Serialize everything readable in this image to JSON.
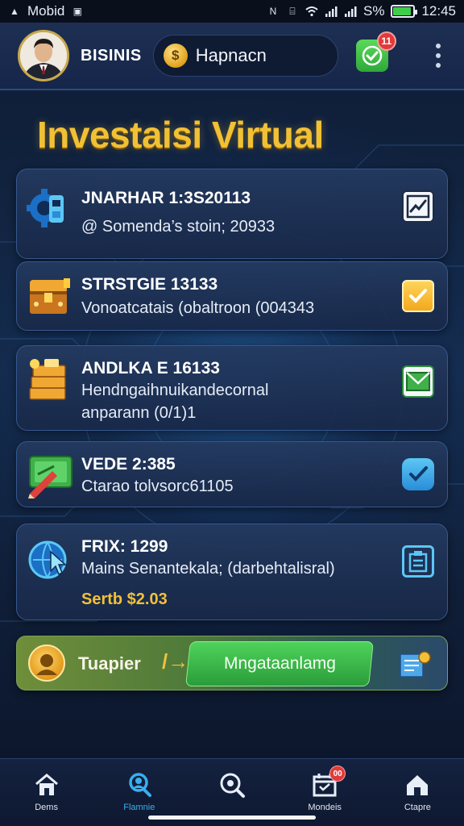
{
  "status_bar": {
    "carrier": "Mobid",
    "battery_percent": "S%",
    "time": "12:45",
    "battery_level": 0.9
  },
  "header": {
    "brand": "BISINIS",
    "balance": "Hapnacn",
    "coin_symbol": "$",
    "notification_count": "11"
  },
  "page": {
    "title": "Investaisi Virtual"
  },
  "cards": [
    {
      "title": "JNARHAR 1:3S20113",
      "subtitle": "@ Somenda’s stoin; 20933",
      "icon": "gear-robot-icon",
      "action_icon": "chart-check-icon"
    },
    {
      "title": "STRSTGIE 13133",
      "subtitle": "Vonoatcatais (obaltroon (004343",
      "icon": "treasure-chest-icon",
      "action_icon": "check-square-icon"
    },
    {
      "title": "ANDLKA E 16133",
      "subtitle": "Hendngaihnuikandecornal",
      "extra": "anparann (0/1)1",
      "icon": "gold-bars-icon",
      "action_icon": "envelope-icon"
    },
    {
      "title": "VEDE 2:385",
      "subtitle": "Ctarao tolvsorc61105",
      "icon": "cash-pencil-icon",
      "action_icon": "check-badge-icon"
    },
    {
      "title": "FRIX: 1299",
      "subtitle": "Mains Senantekala; (darbehtalisral)",
      "amount": "Sertb $2.03",
      "icon": "globe-pointer-icon",
      "action_icon": "clipboard-icon"
    }
  ],
  "cta": {
    "label": "Tuapier",
    "arrow": "/→",
    "button": "Mngataanlamg"
  },
  "bottom_nav": [
    {
      "label": "Dems",
      "icon": "home-icon"
    },
    {
      "label": "Flamnie",
      "icon": "user-search-icon",
      "active": true
    },
    {
      "label": "",
      "icon": "search-icon"
    },
    {
      "label": "Mondeis",
      "icon": "calendar-icon",
      "badge": "00"
    },
    {
      "label": "Ctapre",
      "icon": "house-icon"
    }
  ],
  "colors": {
    "accent_gold": "#f1c135",
    "accent_blue": "#3ab0f0",
    "success_green": "#3ecf4a",
    "badge_red": "#e23a3a"
  }
}
